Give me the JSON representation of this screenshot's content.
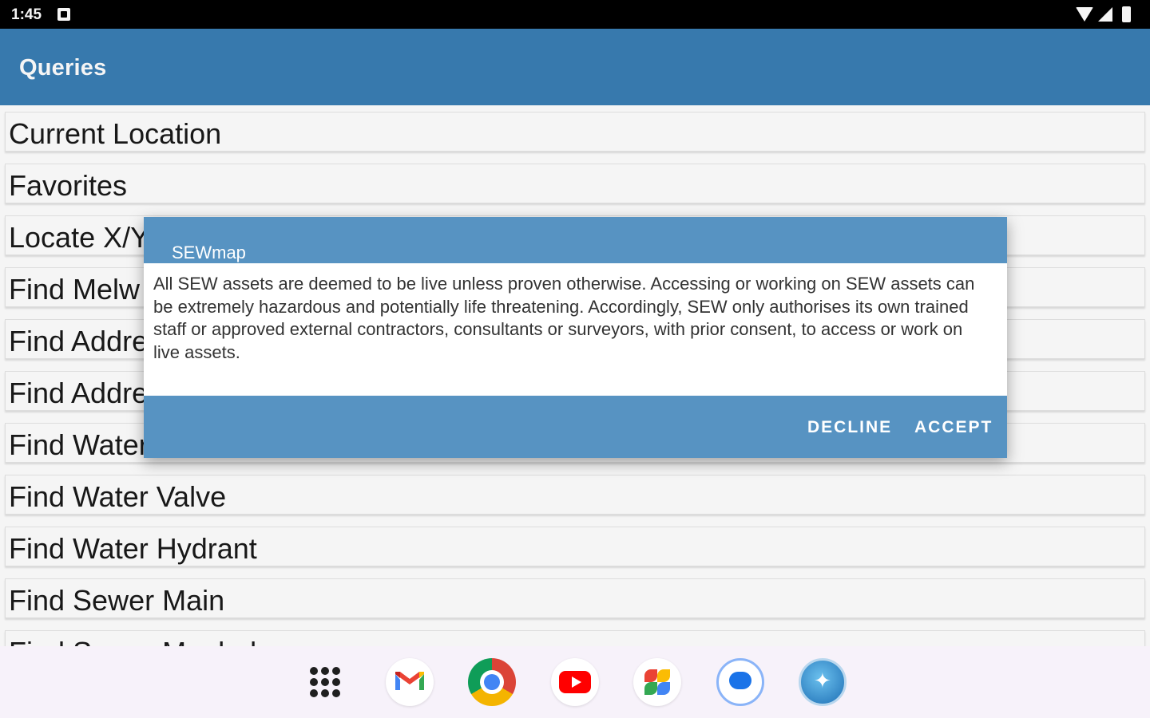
{
  "status_bar": {
    "time": "1:45",
    "icons": [
      "sim-icon",
      "wifi-icon",
      "signal-icon",
      "battery-icon"
    ]
  },
  "app_bar": {
    "title": "Queries",
    "color": "#3a7eb5"
  },
  "list": {
    "items": [
      {
        "label": "Current Location"
      },
      {
        "label": "Favorites"
      },
      {
        "label": "Locate X/Y"
      },
      {
        "label": "Find Melw"
      },
      {
        "label": "Find Addre"
      },
      {
        "label": "Find Addre"
      },
      {
        "label": "Find Water"
      },
      {
        "label": "Find Water Valve"
      },
      {
        "label": "Find Water Hydrant"
      },
      {
        "label": "Find Sewer Main"
      },
      {
        "label": "Find Sewer Manhole"
      }
    ]
  },
  "dialog": {
    "title": "SEWmap",
    "message": "All SEW assets are deemed to be live unless proven otherwise. Accessing or working on SEW assets can be extremely hazardous and potentially life threatening. Accordingly, SEW only authorises its own trained staff or approved external contractors, consultants or surveyors, with prior consent, to access or work on live assets.",
    "decline_label": "DECLINE",
    "accept_label": "ACCEPT",
    "accent_color": "#5793c2"
  },
  "taskbar": {
    "apps": [
      "apps-grid-icon",
      "gmail-icon",
      "chrome-icon",
      "youtube-icon",
      "photos-icon",
      "messages-icon",
      "sewmap-icon"
    ]
  }
}
